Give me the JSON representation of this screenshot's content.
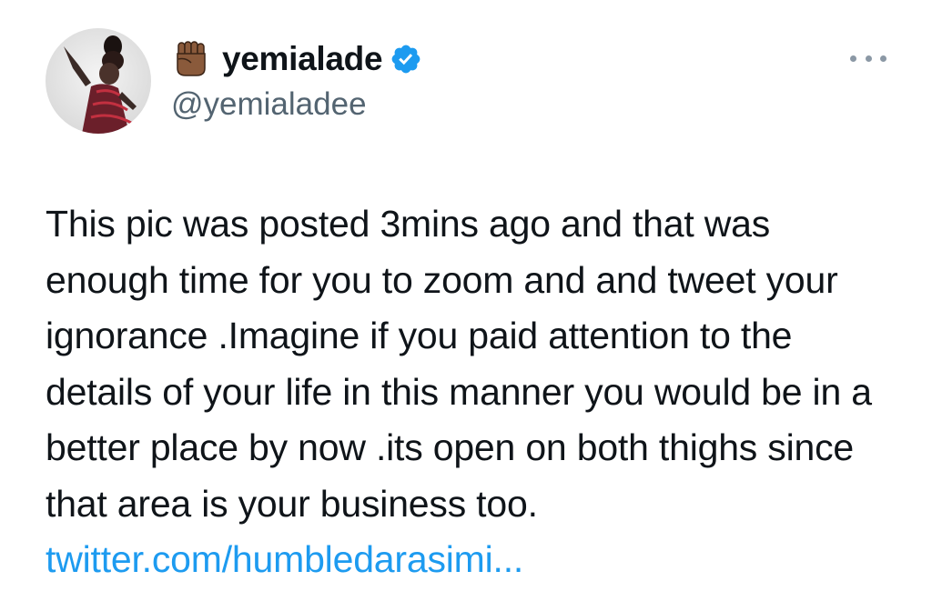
{
  "author": {
    "emoji": "✊🏾",
    "display_name": "yemialade",
    "handle": "@yemialadee",
    "verified": true
  },
  "tweet": {
    "text": "This pic was posted 3mins ago and that was enough time for you to zoom and and tweet your ignorance .Imagine if you paid attention to the details of your life in this manner you would be in a better place by now .its open on both thighs since that area is your business too.",
    "link_text": "twitter.com/humbledarasimi..."
  },
  "colors": {
    "text": "#0f1419",
    "secondary": "#536471",
    "link": "#1d9bf0",
    "verified": "#1d9bf0"
  },
  "icons": {
    "verified": "verified-badge-icon",
    "more": "more-options-icon"
  }
}
